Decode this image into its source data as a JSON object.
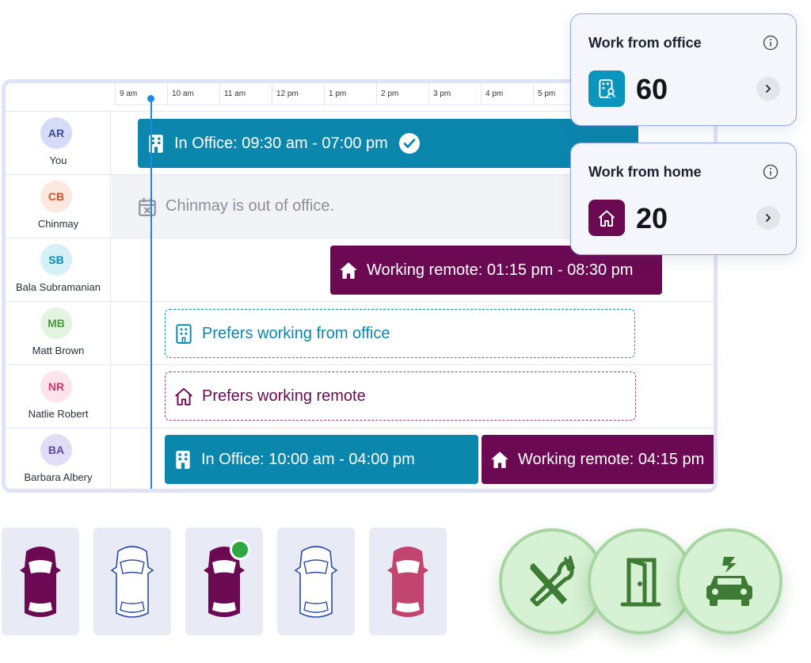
{
  "time_labels": [
    "9 am",
    "10 am",
    "11 am",
    "12 pm",
    "1 pm",
    "2 pm",
    "3 pm",
    "4 pm",
    "5 pm"
  ],
  "people": [
    {
      "initials": "AR",
      "name": "You",
      "avatar_bg": "#d6dcf7",
      "avatar_fg": "#3a4a8a"
    },
    {
      "initials": "CB",
      "name": "Chinmay",
      "avatar_bg": "#fde8e0",
      "avatar_fg": "#c0552e"
    },
    {
      "initials": "SB",
      "name": "Bala Subramanian",
      "avatar_bg": "#d7f0f8",
      "avatar_fg": "#0b86ad"
    },
    {
      "initials": "MB",
      "name": "Matt Brown",
      "avatar_bg": "#e3f4e1",
      "avatar_fg": "#4c9a3f"
    },
    {
      "initials": "NR",
      "name": "Natlie Robert",
      "avatar_bg": "#fde4ec",
      "avatar_fg": "#c63a6a"
    },
    {
      "initials": "BA",
      "name": "Barbara Albery",
      "avatar_bg": "#e2ddf7",
      "avatar_fg": "#5a4aa0"
    }
  ],
  "bars": {
    "you_office": "In Office: 09:30 am - 07:00 pm",
    "chinmay_ooo": "Chinmay is out of office.",
    "bala_remote": "Working remote: 01:15 pm - 08:30 pm",
    "matt_pref": "Prefers working from office",
    "natlie_pref": "Prefers working remote",
    "barbara_office": "In Office: 10:00 am - 04:00 pm",
    "barbara_remote": "Working remote: 04:15 pm"
  },
  "cards": {
    "office": {
      "title": "Work from office",
      "value": "60"
    },
    "home": {
      "title": "Work from home",
      "value": "20"
    }
  },
  "colors": {
    "office": "#0b86ad",
    "remote": "#6b0a52",
    "accent_line": "#1e88e5",
    "available_dot": "#2ea844",
    "amenity_green": "#3e7c35"
  },
  "parking": [
    {
      "state": "occupied",
      "color": "#6b0a52"
    },
    {
      "state": "free",
      "color": "#2b4aa8"
    },
    {
      "state": "occupied-selected",
      "color": "#6b0a52"
    },
    {
      "state": "free",
      "color": "#2b4aa8"
    },
    {
      "state": "occupied",
      "color": "#c2456f"
    }
  ],
  "amenities": [
    "dining-icon",
    "door-icon",
    "electric-car-icon"
  ]
}
